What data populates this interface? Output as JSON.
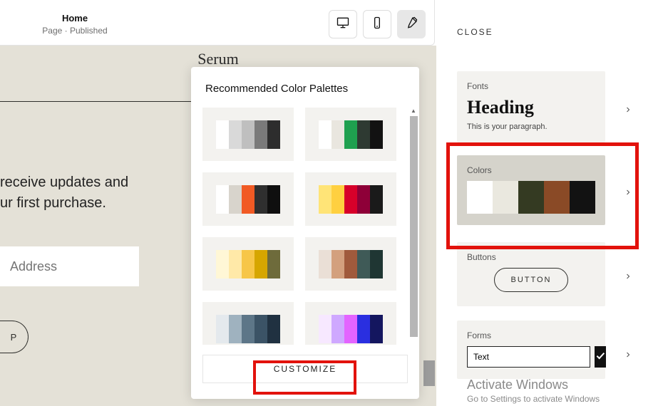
{
  "topbar": {
    "title": "Home",
    "subtitle": "Page · Published"
  },
  "canvas": {
    "heading": "Serum",
    "copy_line1": "receive updates and",
    "copy_line2": "ur first purchase.",
    "email_placeholder": "Address",
    "button_frag": "P"
  },
  "popover": {
    "title": "Recommended Color Palettes",
    "customize": "CUSTOMIZE",
    "palettes": [
      [
        "#ffffff",
        "#d9d9d9",
        "#bfbfbf",
        "#7a7a7a",
        "#2d2d2d"
      ],
      [
        "#ffffff",
        "#e9e6df",
        "#1fa04f",
        "#2e3a32",
        "#121212"
      ],
      [
        "#ffffff",
        "#d8d4cc",
        "#f15a24",
        "#2f2f2f",
        "#0f0f0f"
      ],
      [
        "#ffe477",
        "#ffd040",
        "#d7002a",
        "#8e0038",
        "#1a1a1a"
      ],
      [
        "#fff7d6",
        "#ffe9a8",
        "#f7c648",
        "#d6a600",
        "#6e6b3b"
      ],
      [
        "#eadfd6",
        "#d3a07e",
        "#a05a3c",
        "#3f5a57",
        "#1f3633"
      ],
      [
        "#e4e9ed",
        "#9fb2bf",
        "#5d7688",
        "#3b5366",
        "#203141"
      ],
      [
        "#f7e8ff",
        "#cfa8ff",
        "#e364ff",
        "#2a2fe0",
        "#14165f"
      ]
    ]
  },
  "panel": {
    "close": "CLOSE",
    "fonts_label": "Fonts",
    "heading_preview": "Heading",
    "paragraph_preview": "This is your paragraph.",
    "colors_label": "Colors",
    "colors_palette": [
      "#ffffff",
      "#eae8df",
      "#343a22",
      "#8a4a26",
      "#121212"
    ],
    "buttons_label": "Buttons",
    "button_preview": "BUTTON",
    "forms_label": "Forms",
    "forms_value": "Text"
  },
  "watermark": {
    "title": "Activate Windows",
    "sub": "Go to Settings to activate Windows"
  }
}
